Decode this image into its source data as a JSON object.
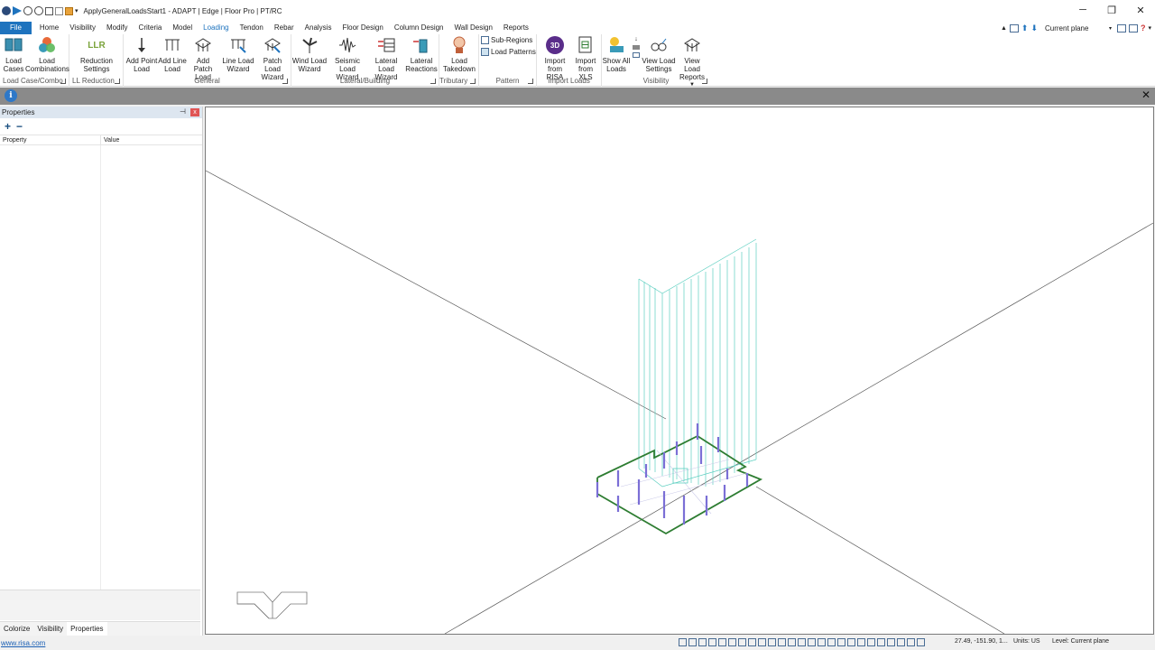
{
  "window": {
    "title": "ApplyGeneralLoadsStart1 - ADAPT | Edge | Floor Pro | PT/RC",
    "controls": [
      "─",
      "❐",
      "✕"
    ]
  },
  "menu": {
    "items": [
      "File",
      "Home",
      "Visibility",
      "Modify",
      "Criteria",
      "Model",
      "Loading",
      "Tendon",
      "Rebar",
      "Analysis",
      "Floor Design",
      "Column Design",
      "Wall Design",
      "Reports"
    ],
    "active": "Loading",
    "plane_select": "Current plane"
  },
  "ribbon": {
    "groups": {
      "load_case": "Load Case/Combo",
      "ll_reduction": "LL Reduction",
      "general": "General",
      "lateral": "Lateral/Building",
      "tributary": "Tributary",
      "pattern": "Pattern",
      "import_loads": "Import Loads",
      "visibility": "Visibility"
    },
    "buttons": {
      "load_cases": "Load Cases",
      "load_combinations": "Load Combinations",
      "llr_icon": "LLR",
      "reduction_settings": "Reduction Settings",
      "add_point_load": "Add Point Load",
      "add_line_load": "Add Line Load",
      "add_patch_load": "Add Patch Load",
      "line_load_wizard": "Line Load Wizard",
      "patch_load_wizard": "Patch Load Wizard",
      "wind_load_wizard": "Wind Load Wizard",
      "seismic_load_wizard": "Seismic Load Wizard",
      "lateral_load_wizard": "Lateral Load Wizard",
      "lateral_reactions": "Lateral Reactions",
      "load_takedown": "Load Takedown",
      "sub_regions": "Sub-Regions",
      "load_patterns": "Load Patterns",
      "risa_icon": "3D",
      "import_risa": "Import from RISA",
      "import_xls": "Import from XLS",
      "show_all_loads": "Show All Loads",
      "view_load_settings": "View Load Settings",
      "view_load_reports": "View Load Reports"
    }
  },
  "info_bar": {
    "icon": "i",
    "close": "✕"
  },
  "properties_panel": {
    "title": "Properties",
    "pin": "📌",
    "close": "x",
    "add": "+",
    "remove": "−",
    "col_property": "Property",
    "col_value": "Value",
    "tabs": [
      "Colorize",
      "Visibility",
      "Properties"
    ],
    "active_tab": "Properties"
  },
  "status": {
    "link": "www.risa.com",
    "coords": "27.49, -151.90, 1...",
    "units": "Units: US",
    "level": "Level: Current plane"
  },
  "colors": {
    "accent": "#1e73be",
    "slab_edge": "#2e7d32",
    "wall_lines": "#5ccfc0",
    "columns": "#7b6fd6"
  }
}
